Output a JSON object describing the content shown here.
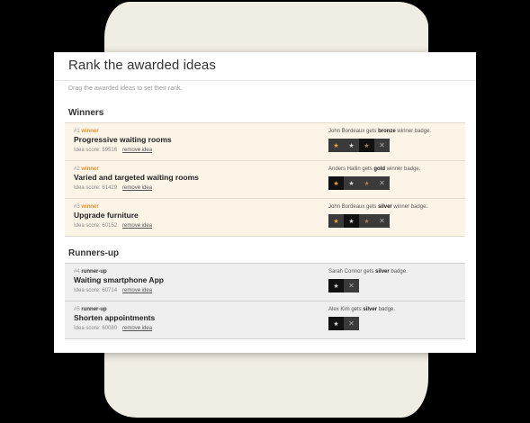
{
  "page": {
    "title": "Rank the awarded ideas",
    "subtitle": "Drag the awarded ideas to set their rank."
  },
  "winners": {
    "heading": "Winners",
    "items": [
      {
        "rank": "#1",
        "type": "winner",
        "name": "Progressive waiting rooms",
        "score_label": "Idea score: 59516",
        "remove_label": "remove idea",
        "person": "John Bordeaux",
        "gets": " gets ",
        "badge": "bronze",
        "suffix": " winner badge.",
        "selected": 2
      },
      {
        "rank": "#2",
        "type": "winner",
        "name": "Varied and targeted waiting rooms",
        "score_label": "Idea score: 61429",
        "remove_label": "remove idea",
        "person": "Anders Hallin",
        "gets": " gets ",
        "badge": "gold",
        "suffix": " winner badge.",
        "selected": 0
      },
      {
        "rank": "#3",
        "type": "winner",
        "name": "Upgrade furniture",
        "score_label": "Idea score: 60152",
        "remove_label": "remove idea",
        "person": "John Bordeaux",
        "gets": " gets ",
        "badge": "silver",
        "suffix": " winner badge.",
        "selected": 1
      }
    ]
  },
  "runners": {
    "heading": "Runners-up",
    "items": [
      {
        "rank": "#4",
        "type": "runner-up",
        "name": "Waiting smartphone App",
        "score_label": "Idea score: 60714",
        "remove_label": "remove idea",
        "person": "Sarah Connor",
        "gets": " gets ",
        "badge": "silver",
        "suffix": " badge."
      },
      {
        "rank": "#5",
        "type": "runner-up",
        "name": "Shorten appointments",
        "score_label": "Idea score: 60080",
        "remove_label": "remove idea",
        "person": "Alex Kim",
        "gets": " gets ",
        "badge": "silver",
        "suffix": " badge."
      }
    ]
  },
  "icons": {
    "star": "★",
    "remove": "✕"
  },
  "colors": {
    "winner_accent": "#e0902a",
    "winner_row_bg": "#fdf4e8",
    "runner_row_bg": "#efefef"
  }
}
